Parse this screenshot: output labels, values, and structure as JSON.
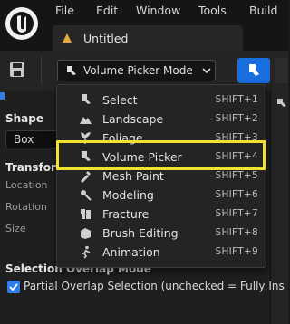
{
  "menubar": {
    "items": [
      "File",
      "Edit",
      "Window",
      "Tools",
      "Build"
    ]
  },
  "document_tab": {
    "title": "Untitled"
  },
  "toolbar": {
    "mode_dropdown_label": "Volume Picker Mode"
  },
  "details": {
    "shape_section": "Shape",
    "shape_value": "Box",
    "transform_section": "Transform",
    "location_label": "Location",
    "rotation_label": "Rotation",
    "size_label": "Size",
    "overlap_section": "Selection Overlap Mode",
    "partial_overlap_label": "Partial Overlap Selection  (unchecked = Fully Ins",
    "partial_overlap_checked": true
  },
  "mode_menu": {
    "items": [
      {
        "label": "Select",
        "shortcut": "SHIFT+1",
        "icon": "select-mode-icon"
      },
      {
        "label": "Landscape",
        "shortcut": "SHIFT+2",
        "icon": "landscape-icon"
      },
      {
        "label": "Foliage",
        "shortcut": "SHIFT+3",
        "icon": "foliage-icon"
      },
      {
        "label": "Volume Picker",
        "shortcut": "SHIFT+4",
        "icon": "volume-picker-icon"
      },
      {
        "label": "Mesh Paint",
        "shortcut": "SHIFT+5",
        "icon": "mesh-paint-icon"
      },
      {
        "label": "Modeling",
        "shortcut": "SHIFT+6",
        "icon": "modeling-icon"
      },
      {
        "label": "Fracture",
        "shortcut": "SHIFT+7",
        "icon": "fracture-icon"
      },
      {
        "label": "Brush Editing",
        "shortcut": "SHIFT+8",
        "icon": "brush-editing-icon"
      },
      {
        "label": "Animation",
        "shortcut": "SHIFT+9",
        "icon": "animation-icon"
      }
    ],
    "highlighted_item": "Volume Picker"
  },
  "colors": {
    "accent_blue": "#1a6fe0",
    "highlight_yellow": "#f3e030",
    "menu_bg": "#242424"
  }
}
